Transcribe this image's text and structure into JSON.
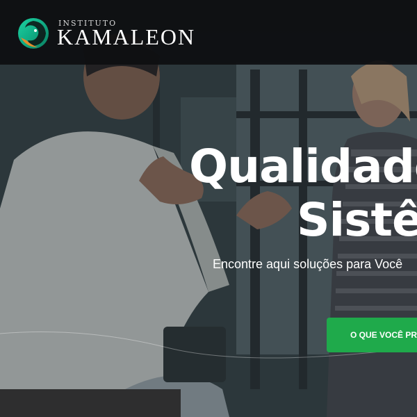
{
  "header": {
    "brand_small": "INSTITUTO",
    "brand_name": "KAMALEON",
    "logo_icon": "kamaleon-chameleon-logo",
    "background": "#0e0f11"
  },
  "hero": {
    "headline_line1": "Qualidade",
    "headline_line2": "Sistê",
    "subtitle": "Encontre aqui soluções para Você",
    "cta_label": "O QUE VOCÊ PR",
    "cta_color": "#1faa4b",
    "image": "two-people-talking-in-office-photo"
  }
}
